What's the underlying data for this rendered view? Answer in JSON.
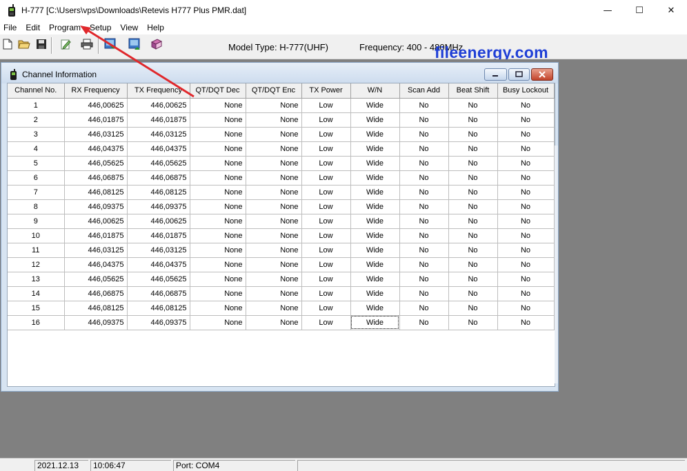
{
  "window": {
    "title": "H-777 [C:\\Users\\vps\\Downloads\\Retevis H777 Plus PMR.dat]",
    "minimize": "—",
    "maximize": "☐",
    "close": "✕"
  },
  "menu": [
    {
      "label": "File"
    },
    {
      "label": "Edit"
    },
    {
      "label": "Program"
    },
    {
      "label": "Setup"
    },
    {
      "label": "View"
    },
    {
      "label": "Help"
    }
  ],
  "toolbar": {
    "icons": [
      "new-file-icon",
      "open-folder-icon",
      "save-disk-icon",
      "edit-notepad-icon",
      "print-icon",
      "read-radio-icon",
      "write-radio-icon",
      "help-book-icon"
    ],
    "model_type": "Model Type:  H-777(UHF)",
    "frequency": "Frequency:  400 - 480MHz"
  },
  "watermark": "fileenergy.com",
  "channel_window": {
    "title": "Channel Information",
    "columns": [
      "Channel No.",
      "RX Frequency",
      "TX Frequency",
      "QT/DQT Dec",
      "QT/DQT Enc",
      "TX Power",
      "W/N",
      "Scan Add",
      "Beat Shift",
      "Busy Lockout"
    ],
    "rows": [
      [
        "1",
        "446,00625",
        "446,00625",
        "None",
        "None",
        "Low",
        "Wide",
        "No",
        "No",
        "No"
      ],
      [
        "2",
        "446,01875",
        "446,01875",
        "None",
        "None",
        "Low",
        "Wide",
        "No",
        "No",
        "No"
      ],
      [
        "3",
        "446,03125",
        "446,03125",
        "None",
        "None",
        "Low",
        "Wide",
        "No",
        "No",
        "No"
      ],
      [
        "4",
        "446,04375",
        "446,04375",
        "None",
        "None",
        "Low",
        "Wide",
        "No",
        "No",
        "No"
      ],
      [
        "5",
        "446,05625",
        "446,05625",
        "None",
        "None",
        "Low",
        "Wide",
        "No",
        "No",
        "No"
      ],
      [
        "6",
        "446,06875",
        "446,06875",
        "None",
        "None",
        "Low",
        "Wide",
        "No",
        "No",
        "No"
      ],
      [
        "7",
        "446,08125",
        "446,08125",
        "None",
        "None",
        "Low",
        "Wide",
        "No",
        "No",
        "No"
      ],
      [
        "8",
        "446,09375",
        "446,09375",
        "None",
        "None",
        "Low",
        "Wide",
        "No",
        "No",
        "No"
      ],
      [
        "9",
        "446,00625",
        "446,00625",
        "None",
        "None",
        "Low",
        "Wide",
        "No",
        "No",
        "No"
      ],
      [
        "10",
        "446,01875",
        "446,01875",
        "None",
        "None",
        "Low",
        "Wide",
        "No",
        "No",
        "No"
      ],
      [
        "11",
        "446,03125",
        "446,03125",
        "None",
        "None",
        "Low",
        "Wide",
        "No",
        "No",
        "No"
      ],
      [
        "12",
        "446,04375",
        "446,04375",
        "None",
        "None",
        "Low",
        "Wide",
        "No",
        "No",
        "No"
      ],
      [
        "13",
        "446,05625",
        "446,05625",
        "None",
        "None",
        "Low",
        "Wide",
        "No",
        "No",
        "No"
      ],
      [
        "14",
        "446,06875",
        "446,06875",
        "None",
        "None",
        "Low",
        "Wide",
        "No",
        "No",
        "No"
      ],
      [
        "15",
        "446,08125",
        "446,08125",
        "None",
        "None",
        "Low",
        "Wide",
        "No",
        "No",
        "No"
      ],
      [
        "16",
        "446,09375",
        "446,09375",
        "None",
        "None",
        "Low",
        "Wide",
        "No",
        "No",
        "No"
      ]
    ]
  },
  "statusbar": {
    "date": "2021.12.13",
    "time": "10:06:47",
    "port": "Port: COM4"
  },
  "colors": {
    "mdi_background": "#808080",
    "watermark": "#1f3fd6",
    "annotation_arrow": "#e0282c"
  }
}
